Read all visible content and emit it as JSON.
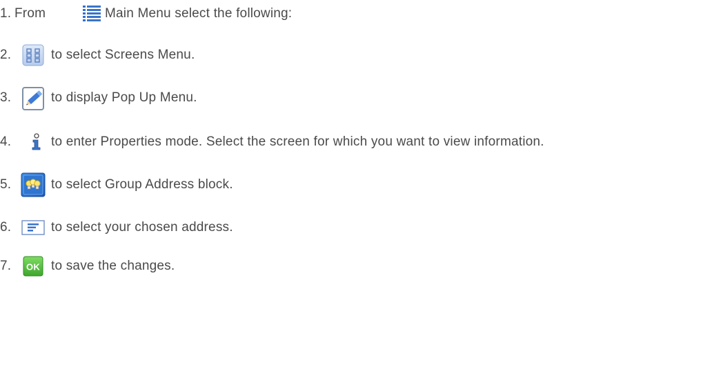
{
  "steps": [
    {
      "number": "1.",
      "lead": "From",
      "icon": "main-menu-icon",
      "text": "Main Menu select the following:"
    },
    {
      "number": "2.",
      "icon": "screens-grid-icon",
      "text": "to select Screens Menu."
    },
    {
      "number": "3.",
      "icon": "edit-pencil-icon",
      "text": "to display Pop Up Menu."
    },
    {
      "number": "4.",
      "icon": "info-icon",
      "text": "to enter Properties mode. Select the screen for which you want to view information."
    },
    {
      "number": "5.",
      "icon": "group-address-bulbs-icon",
      "text": "to select Group Address block."
    },
    {
      "number": "6.",
      "icon": "address-list-icon",
      "text": "to select your chosen address."
    },
    {
      "number": "7.",
      "icon": "ok-icon",
      "text": "to save the changes."
    }
  ],
  "colors": {
    "text": "#4a4a4a",
    "icon_blue": "#3a74c8",
    "ok_green": "#4cb83a"
  }
}
